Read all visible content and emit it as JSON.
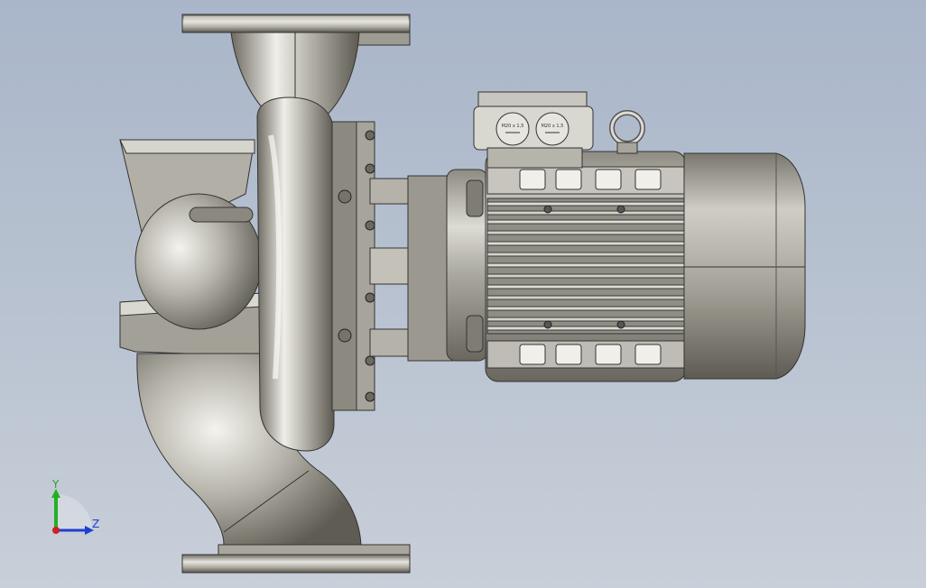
{
  "viewport": {
    "background_top": "#a9b6c9",
    "background_bottom": "#c9cfd9"
  },
  "model": {
    "name": "pump-motor-assembly",
    "parts": [
      "inlet-flange",
      "outlet-flange",
      "volute-casing",
      "pump-bracket",
      "coupling-lantern",
      "electric-motor",
      "terminal-box",
      "lifting-eye",
      "fan-cover"
    ],
    "terminal_labels": [
      "M20 x 1,5",
      "M20 x 1,5"
    ]
  },
  "triad": {
    "y_label": "Y",
    "z_label": "Z",
    "y_color": "#22b022",
    "z_color": "#1f3fd0",
    "origin_color": "#d02020"
  }
}
